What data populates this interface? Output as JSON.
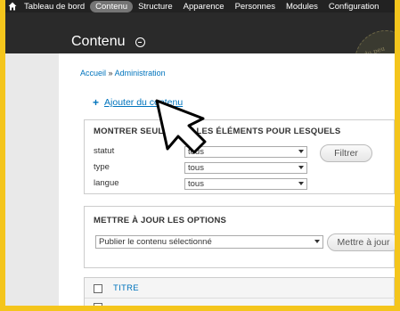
{
  "toolbar": {
    "items": [
      {
        "label": "Tableau de bord",
        "active": false
      },
      {
        "label": "Contenu",
        "active": true
      },
      {
        "label": "Structure",
        "active": false
      },
      {
        "label": "Apparence",
        "active": false
      },
      {
        "label": "Personnes",
        "active": false
      },
      {
        "label": "Modules",
        "active": false
      },
      {
        "label": "Configuration",
        "active": false
      }
    ]
  },
  "header": {
    "title": "Contenu"
  },
  "breadcrumb": {
    "home": "Accueil",
    "separator": "»",
    "current": "Administration"
  },
  "actions": {
    "add_content": "Ajouter du contenu"
  },
  "filter": {
    "heading": "MONTRER SEULEMENT LES ÉLÉMENTS POUR LESQUELS",
    "fields": [
      {
        "label": "statut",
        "value": "tous"
      },
      {
        "label": "type",
        "value": "tous"
      },
      {
        "label": "langue",
        "value": "tous"
      }
    ],
    "button": "Filtrer"
  },
  "update": {
    "heading": "METTRE À JOUR LES OPTIONS",
    "select_value": "Publier le contenu sélectionné",
    "button": "Mettre à jour"
  },
  "table": {
    "columns": [
      "TITRE"
    ]
  },
  "colors": {
    "accent": "#0074bd",
    "toolbar_bg": "#222222",
    "frame": "#f4c51c"
  }
}
